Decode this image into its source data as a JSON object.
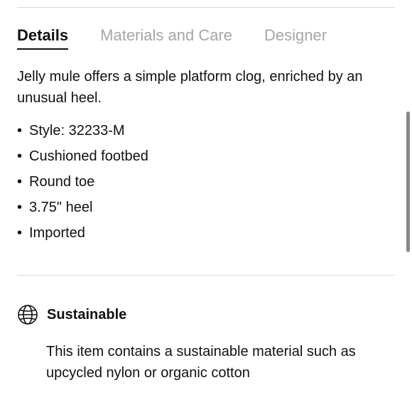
{
  "tabs": [
    {
      "label": "Details",
      "active": true
    },
    {
      "label": "Materials and Care",
      "active": false
    },
    {
      "label": "Designer",
      "active": false
    }
  ],
  "details": {
    "description": "Jelly mule offers a simple platform clog, enriched by an unusual heel.",
    "features": [
      "Style: 32233-M",
      "Cushioned footbed",
      "Round toe",
      "3.75\" heel",
      "Imported"
    ],
    "bullet": "•"
  },
  "sustainable": {
    "icon": "globe-icon",
    "title": "Sustainable",
    "text": "This item contains a sustainable material such as upcycled nylon or organic cotton"
  }
}
